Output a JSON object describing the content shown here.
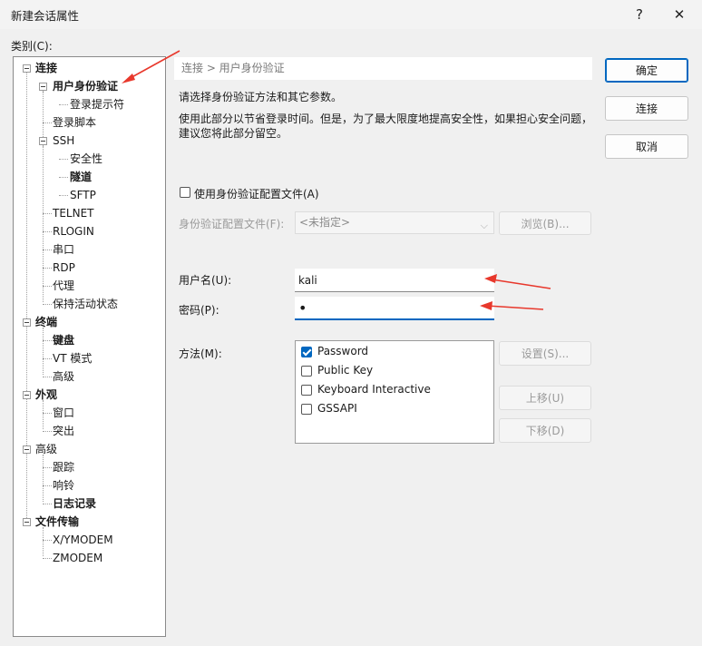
{
  "window": {
    "title": "新建会话属性",
    "help": "?",
    "close": "✕"
  },
  "category_label": "类别(C):",
  "tree": [
    {
      "label": "连接",
      "bold": true
    },
    {
      "label": "用户身份验证",
      "bold": true
    },
    {
      "label": "登录提示符",
      "bold": false
    },
    {
      "label": "登录脚本",
      "bold": false
    },
    {
      "label": "SSH",
      "bold": false
    },
    {
      "label": "安全性",
      "bold": false
    },
    {
      "label": "隧道",
      "bold": true
    },
    {
      "label": "SFTP",
      "bold": false
    },
    {
      "label": "TELNET",
      "bold": false
    },
    {
      "label": "RLOGIN",
      "bold": false
    },
    {
      "label": "串口",
      "bold": false
    },
    {
      "label": "RDP",
      "bold": false
    },
    {
      "label": "代理",
      "bold": false
    },
    {
      "label": "保持活动状态",
      "bold": false
    },
    {
      "label": "终端",
      "bold": true
    },
    {
      "label": "键盘",
      "bold": true
    },
    {
      "label": "VT 模式",
      "bold": false
    },
    {
      "label": "高级",
      "bold": false
    },
    {
      "label": "外观",
      "bold": true
    },
    {
      "label": "窗口",
      "bold": false
    },
    {
      "label": "突出",
      "bold": false
    },
    {
      "label": "高级",
      "bold": false
    },
    {
      "label": "跟踪",
      "bold": false
    },
    {
      "label": "响铃",
      "bold": false
    },
    {
      "label": "日志记录",
      "bold": true
    },
    {
      "label": "文件传输",
      "bold": true
    },
    {
      "label": "X/YMODEM",
      "bold": false
    },
    {
      "label": "ZMODEM",
      "bold": false
    }
  ],
  "breadcrumb": "连接 > 用户身份验证",
  "description_1": "请选择身份验证方法和其它参数。",
  "description_2": "使用此部分以节省登录时间。但是，为了最大限度地提高安全性，如果担心安全问题，",
  "description_3": "建议您将此部分留空。",
  "use_profile_label": "使用身份验证配置文件(A)",
  "profile_label": "身份验证配置文件(F):",
  "profile_value": "<未指定>",
  "browse_button": "浏览(B)...",
  "username_label": "用户名(U):",
  "username_value": "kali",
  "password_label": "密码(P):",
  "password_value": "•",
  "method_label": "方法(M):",
  "methods": [
    {
      "label": "Password",
      "checked": true
    },
    {
      "label": "Public Key",
      "checked": false
    },
    {
      "label": "Keyboard Interactive",
      "checked": false
    },
    {
      "label": "GSSAPI",
      "checked": false
    }
  ],
  "settings_button": "设置(S)...",
  "up_button": "上移(U)",
  "down_button": "下移(D)",
  "ok_button": "确定",
  "connect_button": "连接",
  "cancel_button": "取消",
  "colors": {
    "accent": "#0067c0",
    "arrow": "#e8382c"
  }
}
